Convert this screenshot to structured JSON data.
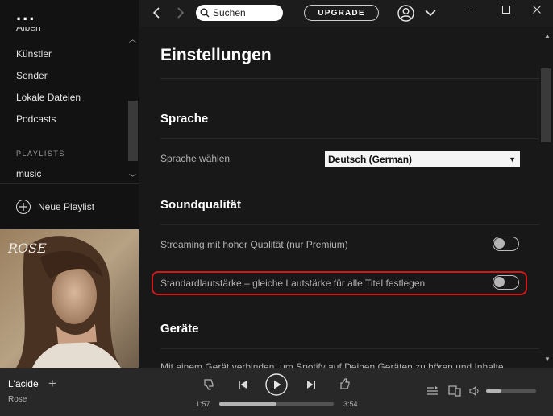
{
  "sidebar": {
    "menu": "...",
    "partial_item": "Alben",
    "items": [
      {
        "label": "Künstler"
      },
      {
        "label": "Sender"
      },
      {
        "label": "Lokale Dateien"
      },
      {
        "label": "Podcasts"
      }
    ],
    "playlists_heading": "PLAYLISTS",
    "playlists": [
      {
        "label": "music"
      }
    ],
    "new_playlist_label": "Neue Playlist",
    "cover_text": "ROSE"
  },
  "topbar": {
    "search_placeholder": "Suchen",
    "upgrade_label": "UPGRADE"
  },
  "settings": {
    "title": "Einstellungen",
    "sections": [
      {
        "heading": "Sprache"
      },
      {
        "heading": "Soundqualität"
      },
      {
        "heading": "Geräte"
      }
    ],
    "language": {
      "label": "Sprache wählen",
      "selected": "Deutsch (German)"
    },
    "streaming_high_quality": {
      "label": "Streaming mit hoher Qualität (nur Premium)",
      "enabled": false
    },
    "normalize_volume": {
      "label": "Standardlautstärke – gleiche Lautstärke für alle Titel festlegen",
      "enabled": false,
      "highlight_color": "#d21818"
    },
    "devices_text_partial": "Mit einem Gerät verbinden, um Spotify auf Deinen Geräten zu hören und Inhalte"
  },
  "player": {
    "track_title": "L'acide",
    "artist": "Rose",
    "elapsed": "1:57",
    "duration": "3:54",
    "progress": 0.5,
    "volume": 0.3
  },
  "colors": {
    "background": "#121212",
    "main_background": "#181818",
    "player_background": "#282828",
    "text_secondary": "#b3b3b3",
    "highlight": "#d21818"
  },
  "icons": {
    "back": "chevron-left-icon",
    "forward": "chevron-right-icon",
    "search": "search-icon",
    "user": "user-icon",
    "menu": "chevron-down-icon",
    "minimize": "minimize-icon",
    "maximize": "maximize-icon",
    "close": "close-icon",
    "add": "plus-icon",
    "new_playlist": "plus-circle-icon",
    "dislike": "thumbs-down-icon",
    "previous": "skip-back-icon",
    "play": "play-icon",
    "next": "skip-forward-icon",
    "like": "thumbs-up-icon",
    "queue": "queue-icon",
    "devices": "devices-icon",
    "volume": "volume-icon"
  }
}
